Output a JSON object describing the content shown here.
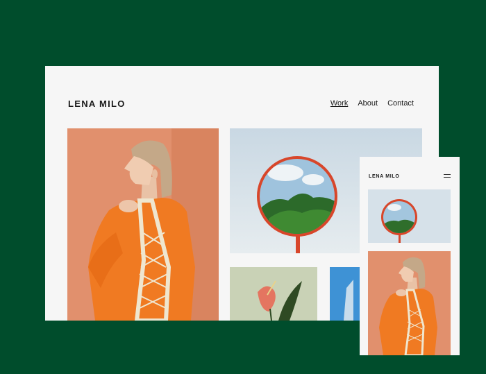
{
  "site": {
    "brand": "LENA MILO",
    "nav": [
      {
        "label": "Work",
        "active": true
      },
      {
        "label": "About",
        "active": false
      },
      {
        "label": "Contact",
        "active": false
      }
    ]
  },
  "mobile": {
    "brand": "LENA MILO",
    "menu_icon": "hamburger-menu-icon"
  },
  "colors": {
    "background": "#004d2c",
    "page": "#f6f6f6",
    "portrait_bg": "#e1906d",
    "sweater": "#f07a22",
    "mirror_frame": "#d8462a"
  }
}
